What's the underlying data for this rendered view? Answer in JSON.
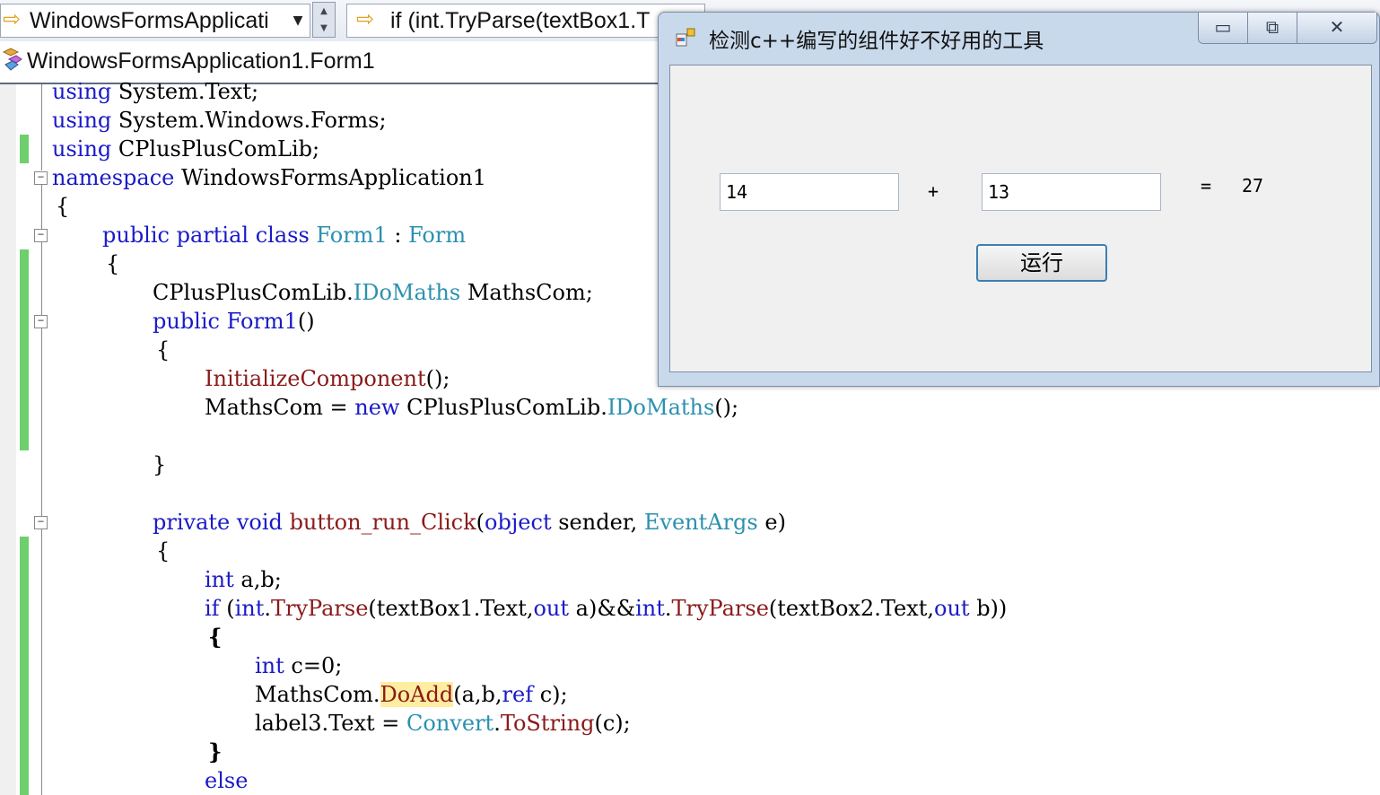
{
  "ide": {
    "class_dropdown": "WindowsFormsApplicati",
    "member_dropdown": "if (int.TryParse(textBox1.T",
    "tab": "WindowsFormsApplication1.Form1"
  },
  "code": {
    "l1": [
      "using",
      " System.Text;"
    ],
    "l2": [
      "using",
      " System.Windows.Forms;"
    ],
    "l3": [
      "using",
      " CPlusPlusComLib;"
    ],
    "l4": [
      "namespace",
      " WindowsFormsApplication1"
    ],
    "l5": "{",
    "l6": [
      "public",
      " ",
      "partial",
      " ",
      "class",
      " ",
      "Form1",
      " : ",
      "Form"
    ],
    "l7": "{",
    "l8": [
      "CPlusPlusComLib.",
      "IDoMaths",
      " MathsCom;"
    ],
    "l9": [
      "public",
      " ",
      "Form1",
      "()"
    ],
    "l10": "{",
    "l11": [
      "InitializeComponent",
      "();"
    ],
    "l12": [
      "MathsCom = ",
      "new",
      " CPlusPlusComLib.",
      "IDoMaths",
      "();"
    ],
    "l13": "}",
    "l14": [
      "private",
      " ",
      "void",
      " ",
      "button_run_Click",
      "(",
      "object",
      " sender, ",
      "EventArgs",
      " e)"
    ],
    "l15": "{",
    "l16": [
      "int",
      " a,b;"
    ],
    "l17": [
      "if",
      " (",
      "int",
      ".",
      "TryParse",
      "(textBox1.Text,",
      "out",
      " a)&&",
      "int",
      ".",
      "TryParse",
      "(textBox2.Text,",
      "out",
      " b))"
    ],
    "l18": "{",
    "l19": [
      "int",
      " c=0;"
    ],
    "l20": [
      "MathsCom.",
      "DoAdd",
      "(a,b,",
      "ref",
      " c);"
    ],
    "l21": [
      "label3.Text = ",
      "Convert",
      ".",
      "ToString",
      "(c);"
    ],
    "l22": "}",
    "l23": "else"
  },
  "form": {
    "title": "检测c++编写的组件好不好用的工具",
    "textbox1": "14",
    "plus": "+",
    "textbox2": "13",
    "equals": "=",
    "result": "27",
    "run_button": "运行",
    "minimize": "▭",
    "maximize": "⧉",
    "close": "✕"
  }
}
